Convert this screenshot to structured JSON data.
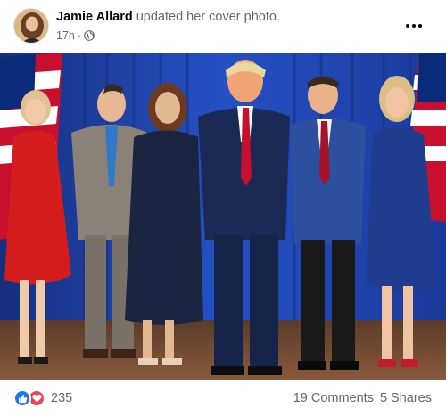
{
  "post": {
    "author": "Jamie Allard",
    "action": "updated her cover photo.",
    "time": "17h",
    "separator": "·",
    "privacy_icon": "globe-icon",
    "more_icon": "more-options-icon"
  },
  "reactions": {
    "icons": [
      "like-icon",
      "love-icon"
    ],
    "count": "235"
  },
  "stats": {
    "comments": "19 Comments",
    "shares": "5 Shares"
  },
  "colors": {
    "like": "#1877f2",
    "love": "#f33e58",
    "muted_text": "#65676b",
    "backdrop_blue": "#1d3f9e"
  }
}
